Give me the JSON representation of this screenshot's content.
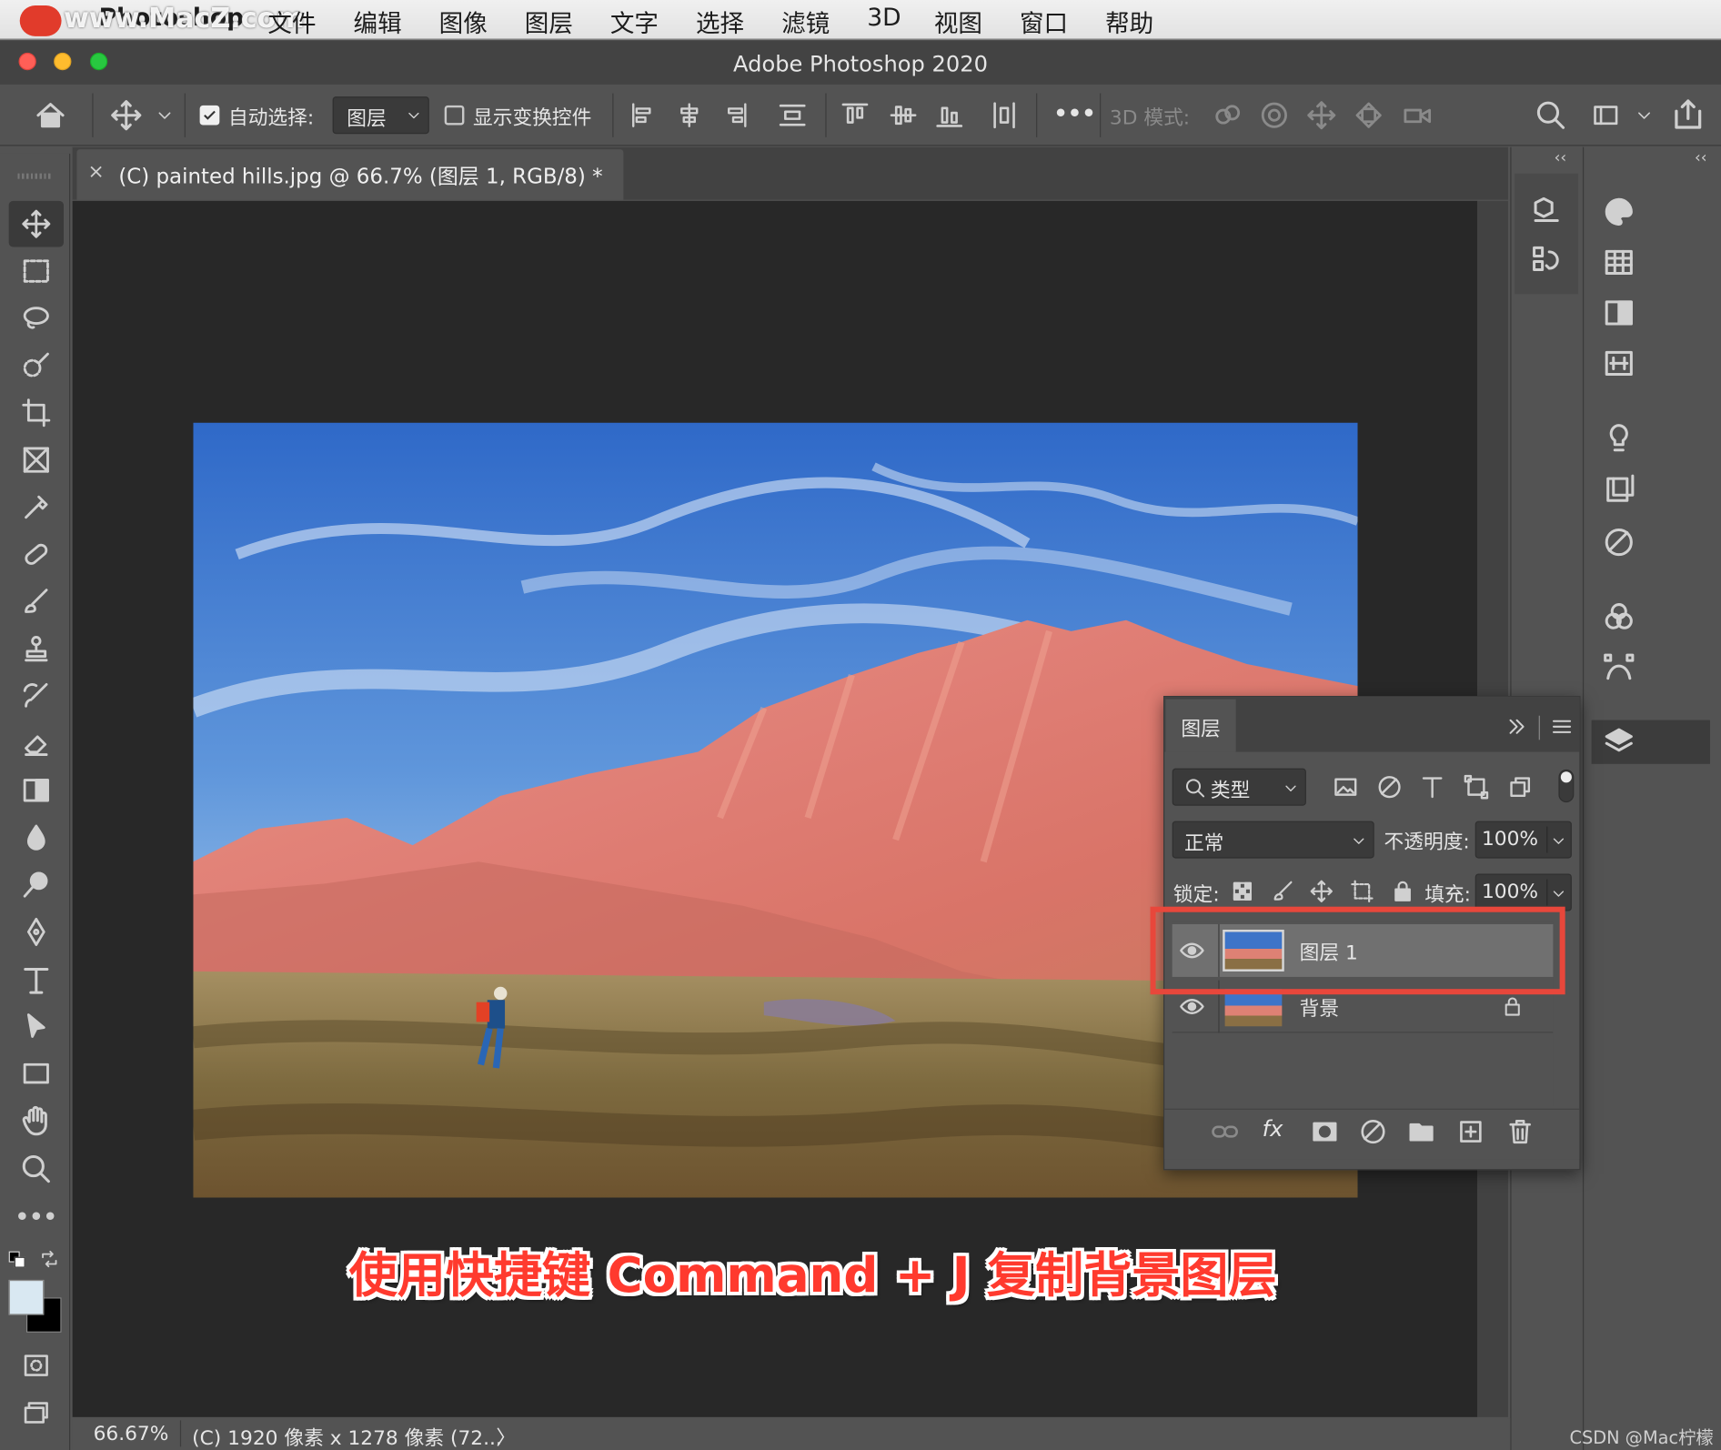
{
  "menubar": {
    "app_name": "Photoshop",
    "watermark": "www.MacZ.com",
    "items": [
      "文件",
      "编辑",
      "图像",
      "图层",
      "文字",
      "选择",
      "滤镜",
      "3D",
      "视图",
      "窗口",
      "帮助"
    ]
  },
  "window": {
    "title": "Adobe Photoshop 2020"
  },
  "options_bar": {
    "auto_select_label": "自动选择:",
    "auto_select_checked": true,
    "auto_select_value": "图层",
    "show_transform_label": "显示变换控件",
    "show_transform_checked": false,
    "more_label": "•••",
    "mode_3d_label": "3D 模式:"
  },
  "document": {
    "tab_title": "(C) painted hills.jpg @ 66.7% (图层 1, RGB/8) *",
    "close_glyph": "×"
  },
  "panel_toggles": {
    "left": "››",
    "right_a": "‹‹",
    "right_b": "‹‹"
  },
  "layers_panel": {
    "title": "图层",
    "filter_label": "类型",
    "blend_mode": "正常",
    "opacity_label": "不透明度:",
    "opacity_value": "100%",
    "lock_label": "锁定:",
    "fill_label": "填充:",
    "fill_value": "100%",
    "layers": [
      {
        "name": "图层 1",
        "selected": true,
        "visible": true,
        "locked": false
      },
      {
        "name": "背景",
        "selected": false,
        "visible": true,
        "locked": true
      }
    ],
    "footer_fx": "fx"
  },
  "status": {
    "zoom": "66.67%",
    "info": "(C) 1920 像素 x 1278 像素 (72...",
    "arrow": "〉"
  },
  "annotation": "使用快捷键 Command + J 复制背景图层",
  "credit": "CSDN @Mac柠檬",
  "colors": {
    "highlight_box": "#e8473b",
    "annotation_text": "#ff3a2e",
    "ui_dark": "#535353",
    "canvas_bg": "#282828"
  }
}
